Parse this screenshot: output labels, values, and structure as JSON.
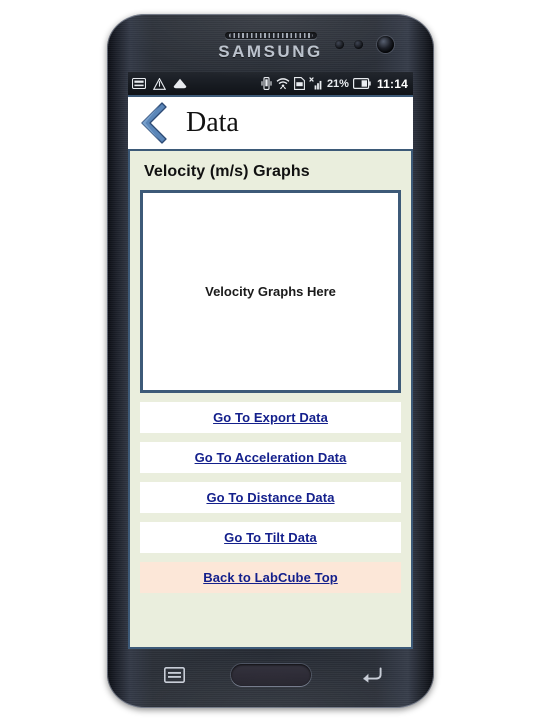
{
  "device": {
    "brand_label": "SAMSUNG",
    "speaker_name": "earpiece-speaker",
    "home_button_label": "",
    "menu_key_label": "",
    "back_key_label": ""
  },
  "statusbar": {
    "left_icons": [
      "keyboard-icon",
      "warning-triangle-icon",
      "cloud-icon"
    ],
    "right_icons": [
      "vibrate-icon",
      "wifi-icon",
      "sd-card-icon",
      "signal-bars-icon"
    ],
    "battery_percent": "21%",
    "battery_icon": "battery-icon",
    "clock": "11:14"
  },
  "titlebar": {
    "back_icon": "back-chevron-icon",
    "title": "Data"
  },
  "main": {
    "heading": "Velocity (m/s) Graphs",
    "graph_placeholder": "Velocity Graphs Here",
    "buttons": [
      {
        "label": "Go To Export Data",
        "accent": false
      },
      {
        "label": "Go To Acceleration Data",
        "accent": false
      },
      {
        "label": "Go To Distance Data",
        "accent": false
      },
      {
        "label": "Go To Tilt Data",
        "accent": false
      },
      {
        "label": "Back to LabCube Top",
        "accent": true
      }
    ]
  },
  "colors": {
    "page_bg": "#eaeedd",
    "frame_blue": "#3d5a78",
    "link_navy": "#14208c",
    "accent_peach": "#fce7d8",
    "statusbar_bg": "#171b21"
  }
}
